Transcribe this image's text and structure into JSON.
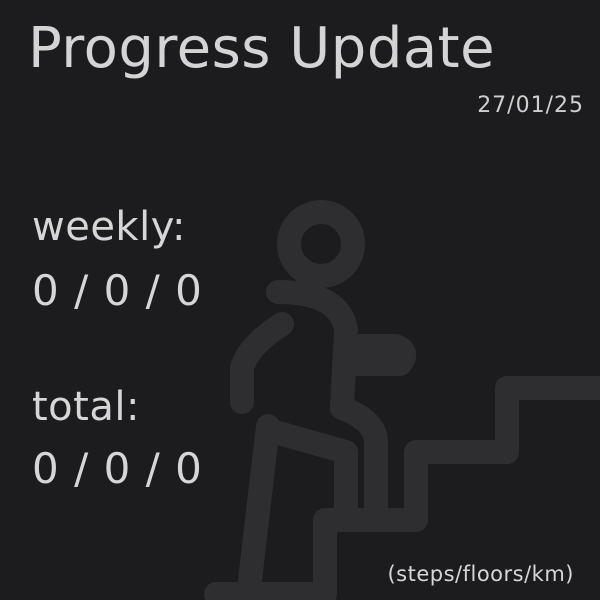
{
  "header": {
    "title": "Progress Update",
    "date": "27/01/25"
  },
  "stats": {
    "weekly_label": "weekly:",
    "weekly_value": "0 / 0 / 0",
    "total_label": "total:",
    "total_value": "0 / 0 / 0"
  },
  "footer": {
    "units": "(steps/floors/km)"
  },
  "background_icon": "person-climbing-stairs-icon",
  "colors": {
    "background": "#1c1c1e",
    "text": "#d4d4d4",
    "icon": "#2e2e30"
  }
}
